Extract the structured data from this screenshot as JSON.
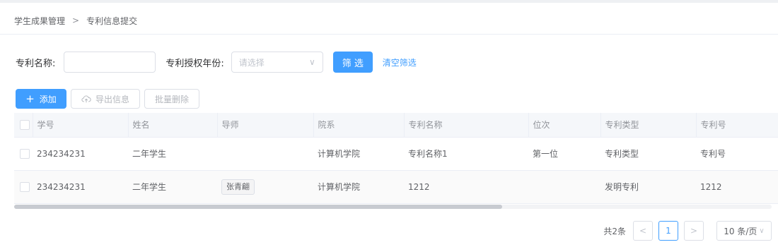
{
  "breadcrumb": {
    "parent": "学生成果管理",
    "separator": ">",
    "current": "专利信息提交"
  },
  "filters": {
    "name_label": "专利名称:",
    "name_value": "",
    "year_label": "专利授权年份:",
    "year_placeholder": "请选择",
    "filter_button": "筛 选",
    "clear_link": "清空筛选"
  },
  "toolbar": {
    "add_label": "添加",
    "export_label": "导出信息",
    "batch_delete_label": "批量删除"
  },
  "table": {
    "columns": [
      "学号",
      "姓名",
      "导师",
      "院系",
      "专利名称",
      "位次",
      "专利类型",
      "专利号"
    ],
    "rows": [
      {
        "student_id": "234234231",
        "name": "二年学生",
        "advisor": "",
        "department": "计算机学院",
        "patent_name": "专利名称1",
        "rank": "第一位",
        "patent_type": "专利类型",
        "patent_no": "专利号"
      },
      {
        "student_id": "234234231",
        "name": "二年学生",
        "advisor": "张青翩",
        "department": "计算机学院",
        "patent_name": "1212",
        "rank": "",
        "patent_type": "发明专利",
        "patent_no": "1212"
      }
    ]
  },
  "pagination": {
    "total": "共2条",
    "prev": "<",
    "current_page": "1",
    "next": ">",
    "page_size": "10 条/页"
  },
  "colors": {
    "primary": "#409eff",
    "header_bg": "#f5f7fa",
    "border": "#dcdfe6"
  }
}
